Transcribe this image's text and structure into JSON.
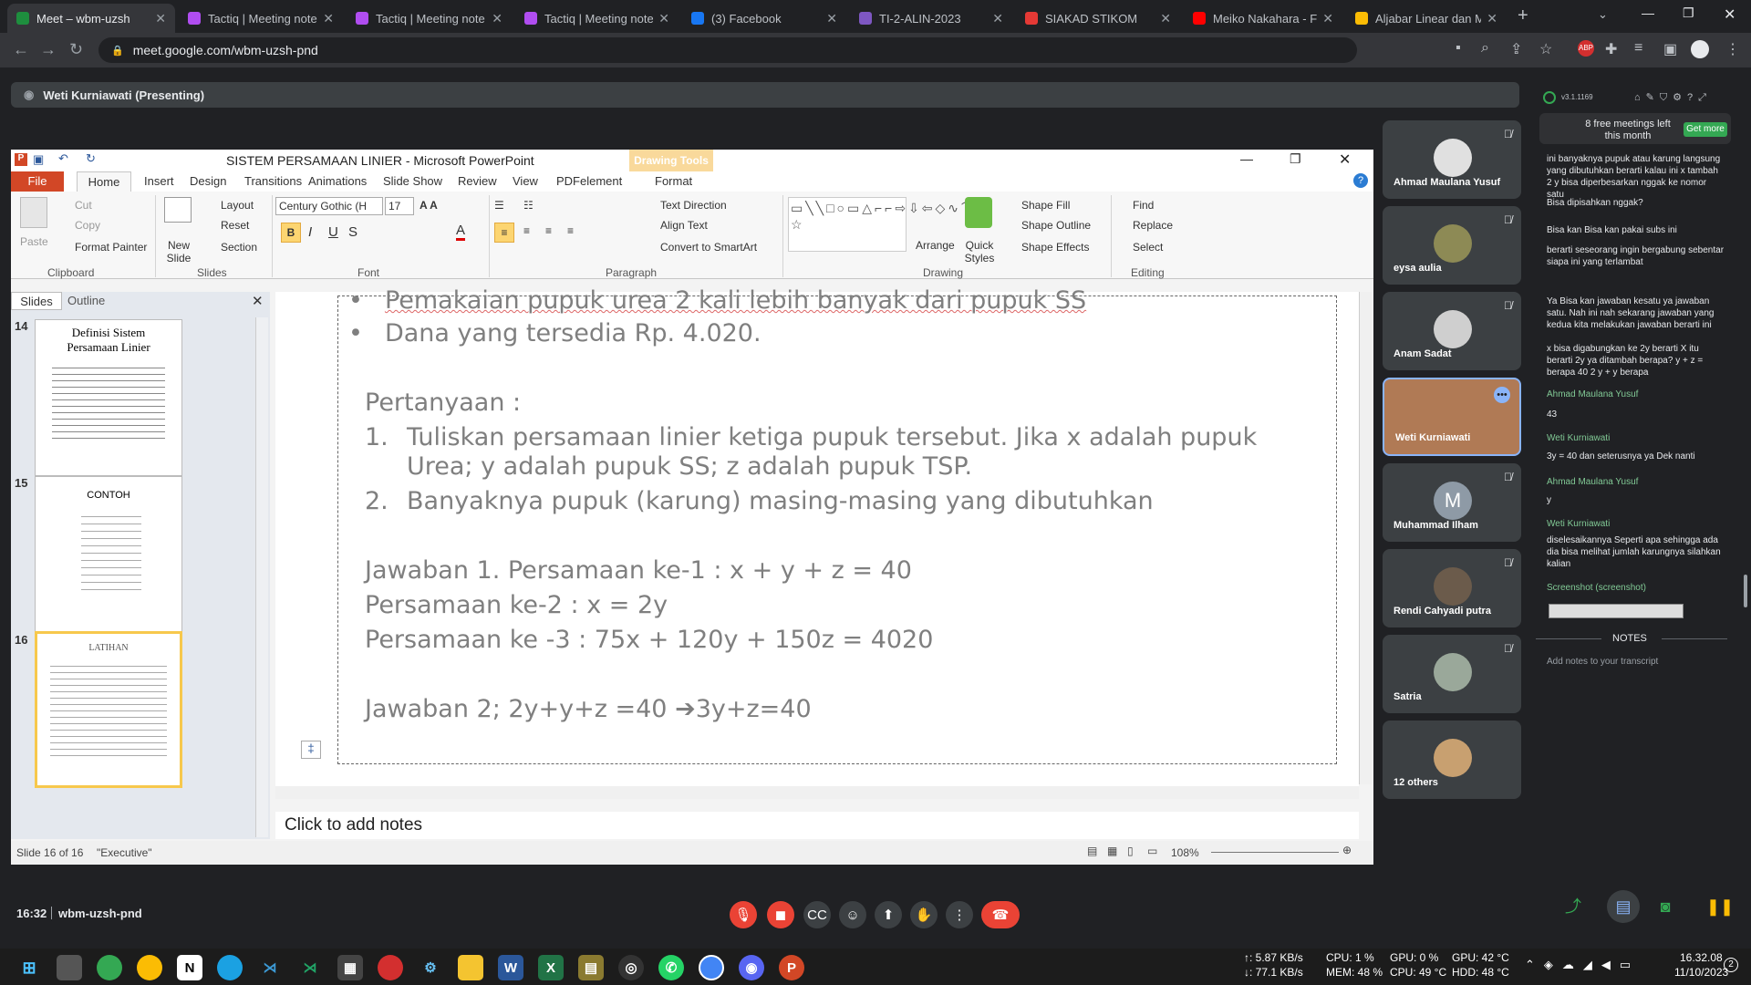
{
  "browser": {
    "tabs": [
      {
        "title": "Meet – wbm-uzsh",
        "color": "#1e8e3e"
      },
      {
        "title": "Tactiq | Meeting note",
        "color": "#b04df0"
      },
      {
        "title": "Tactiq | Meeting note",
        "color": "#b04df0"
      },
      {
        "title": "Tactiq | Meeting note",
        "color": "#b04df0"
      },
      {
        "title": "(3) Facebook",
        "color": "#1877f2"
      },
      {
        "title": "TI-2-ALIN-2023",
        "color": "#7e57c2"
      },
      {
        "title": "SIAKAD STIKOM",
        "color": "#e53935"
      },
      {
        "title": "Meiko Nakahara - Fa",
        "color": "#ff0000"
      },
      {
        "title": "Aljabar Linear dan M",
        "color": "#fbbc04"
      }
    ],
    "url": "meet.google.com/wbm-uzsh-pnd"
  },
  "meet": {
    "presenter": "Weti Kurniawati (Presenting)",
    "time": "16:32",
    "meeting_code": "wbm-uzsh-pnd"
  },
  "ppt": {
    "window_title": "SISTEM PERSAMAAN LINIER - Microsoft PowerPoint",
    "drawing_tools": "Drawing Tools",
    "format_tab": "Format",
    "tabs": [
      "File",
      "Home",
      "Insert",
      "Design",
      "Transitions",
      "Animations",
      "Slide Show",
      "Review",
      "View",
      "PDFelement"
    ],
    "clipboard": {
      "paste": "Paste",
      "cut": "Cut",
      "copy": "Copy",
      "format_painter": "Format Painter",
      "group": "Clipboard"
    },
    "slides_group": {
      "new_slide": "New Slide",
      "layout": "Layout",
      "reset": "Reset",
      "section": "Section",
      "group": "Slides"
    },
    "font": {
      "name": "Century Gothic (H",
      "size": "17",
      "group": "Font"
    },
    "paragraph": {
      "text_direction": "Text Direction",
      "align_text": "Align Text",
      "smartart": "Convert to SmartArt",
      "group": "Paragraph"
    },
    "drawing": {
      "arrange": "Arrange",
      "quick_styles": "Quick Styles",
      "shape_fill": "Shape Fill",
      "shape_outline": "Shape Outline",
      "shape_effects": "Shape Effects",
      "group": "Drawing"
    },
    "editing": {
      "find": "Find",
      "replace": "Replace",
      "select": "Select",
      "group": "Editing"
    },
    "pane_tabs": {
      "slides": "Slides",
      "outline": "Outline"
    },
    "thumbnails": [
      {
        "num": "14",
        "title": "Definisi Sistem Persamaan Linier"
      },
      {
        "num": "15",
        "title": "CONTOH"
      },
      {
        "num": "16",
        "title": "LATIHAN"
      }
    ],
    "slide_lines": {
      "b1": "Pemakaian pupuk urea 2 kali lebih banyak dari pupuk SS",
      "b2": "Dana yang tersedia Rp. 4.020.",
      "q": "Pertanyaan :",
      "q1n": "1.",
      "q1a": "Tuliskan persamaan linier ketiga pupuk tersebut. Jika x adalah pupuk",
      "q1b": "Urea; y adalah pupuk SS; z adalah pupuk TSP.",
      "q2n": "2.",
      "q2": "Banyaknya pupuk (karung) masing-masing yang dibutuhkan",
      "a1": "Jawaban 1. Persamaan ke-1 : x + y + z = 40",
      "a2": "Persamaan ke-2 : x = 2y",
      "a3": "Persamaan ke -3 : 75x + 120y + 150z = 4020",
      "a4": "Jawaban 2; 2y+y+z =40 ➔3y+z=40"
    },
    "notes": "Click to add notes",
    "status": {
      "slide": "Slide 16 of 16",
      "theme": "\"Executive\"",
      "zoom": "108%"
    }
  },
  "participants": [
    {
      "name": "Ahmad Maulana Yusuf",
      "muted": true,
      "color": "#e0e0e0"
    },
    {
      "name": "eysa aulia",
      "muted": true,
      "color": "#8d8a55"
    },
    {
      "name": "Anam Sadat",
      "muted": true,
      "color": "#cfcfcf"
    },
    {
      "name": "Weti Kurniawati",
      "muted": false,
      "color": "#b07a55"
    },
    {
      "name": "Muhammad Ilham",
      "muted": true,
      "color": "#8e9aa6",
      "initial": "M"
    },
    {
      "name": "Rendi Cahyadi putra",
      "muted": true,
      "color": "#6b5b4b"
    },
    {
      "name": "Satria",
      "muted": true,
      "color": "#9aa89a"
    },
    {
      "name": "12 others",
      "muted": false,
      "color": "#c8a070"
    }
  ],
  "side_panel": {
    "version": "v3.1.1169",
    "banner": "8 free meetings left this month",
    "get_more": "Get more",
    "chat": [
      {
        "text": "ini banyaknya pupuk atau karung langsung yang dibutuhkan berarti kalau ini x tambah 2 y bisa diperbesarkan nggak ke nomor satu",
        "g": false
      },
      {
        "text": "Bisa dipisahkan nggak?",
        "g": false
      },
      {
        "text": "Bisa kan Bisa kan pakai subs ini",
        "g": false
      },
      {
        "text": "berarti seseorang ingin bergabung sebentar siapa ini yang terlambat",
        "g": false
      },
      {
        "text": "Ya Bisa kan jawaban kesatu ya jawaban satu. Nah ini nah sekarang jawaban yang kedua kita melakukan jawaban berarti ini",
        "g": false
      },
      {
        "text": "x bisa digabungkan ke 2y berarti X itu berarti 2y ya ditambah berapa? y + z = berapa 40 2 y + y berapa",
        "g": false
      },
      {
        "text": "Ahmad Maulana Yusuf",
        "g": true
      },
      {
        "text": "43",
        "g": false
      },
      {
        "text": "Weti Kurniawati",
        "g": true
      },
      {
        "text": "3y = 40 dan seterusnya ya Dek nanti",
        "g": false
      },
      {
        "text": "Ahmad Maulana Yusuf",
        "g": true
      },
      {
        "text": "y",
        "g": false
      },
      {
        "text": "Weti Kurniawati",
        "g": true
      },
      {
        "text": "diselesaikannya Seperti apa sehingga ada dia bisa melihat jumlah karungnya silahkan kalian",
        "g": false
      },
      {
        "text": "Screenshot (screenshot)",
        "g": true
      }
    ],
    "notes_heading": "NOTES",
    "notes_placeholder": "Add notes to your transcript"
  },
  "taskbar": {
    "net_up": "↑: 5.87 KB/s",
    "net_down": "↓: 77.1 KB/s",
    "cpu": "CPU: 1 %",
    "mem": "MEM: 48 %",
    "gpu": "GPU: 0 %",
    "cpu_temp": "CPU: 49 °C",
    "gpu_temp": "GPU: 42 °C",
    "hdd_temp": "HDD: 48 °C",
    "clock_time": "16.32.08",
    "clock_date": "11/10/2023",
    "notif_count": "2"
  }
}
